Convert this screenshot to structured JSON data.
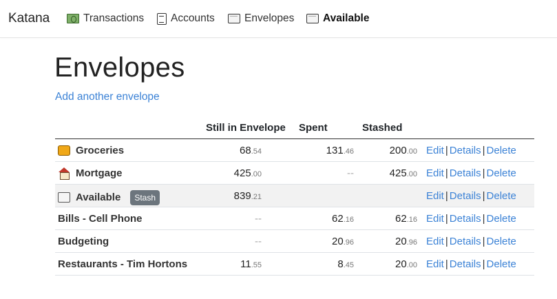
{
  "navbar": {
    "brand": "Katana",
    "items": [
      {
        "label": "Transactions",
        "icon": "money-icon",
        "active": false
      },
      {
        "label": "Accounts",
        "icon": "ledger-icon",
        "active": false
      },
      {
        "label": "Envelopes",
        "icon": "envelope-icon",
        "active": false
      },
      {
        "label": "Available",
        "icon": "envelope-icon",
        "active": true
      }
    ]
  },
  "page": {
    "title": "Envelopes",
    "add_link": "Add another envelope"
  },
  "table": {
    "headers": {
      "still": "Still in Envelope",
      "spent": "Spent",
      "stashed": "Stashed"
    },
    "rows": [
      {
        "name": "Groceries",
        "icon": "groceries-icon",
        "still_whole": "68",
        "still_cents": ".54",
        "spent_whole": "131",
        "spent_cents": ".46",
        "stashed_whole": "200",
        "stashed_cents": ".00",
        "edit": "Edit",
        "details": "Details",
        "delete": "Delete"
      },
      {
        "name": "Mortgage",
        "icon": "house-icon",
        "still_whole": "425",
        "still_cents": ".00",
        "spent_empty": "--",
        "stashed_whole": "425",
        "stashed_cents": ".00",
        "edit": "Edit",
        "details": "Details",
        "delete": "Delete"
      },
      {
        "name": "Available",
        "icon": "envelope-icon",
        "badge": "Stash",
        "still_whole": "839",
        "still_cents": ".21",
        "edit": "Edit",
        "details": "Details",
        "delete": "Delete"
      },
      {
        "name": "Bills - Cell Phone",
        "still_empty": "--",
        "spent_whole": "62",
        "spent_cents": ".16",
        "stashed_whole": "62",
        "stashed_cents": ".16",
        "edit": "Edit",
        "details": "Details",
        "delete": "Delete"
      },
      {
        "name": "Budgeting",
        "still_empty": "--",
        "spent_whole": "20",
        "spent_cents": ".96",
        "stashed_whole": "20",
        "stashed_cents": ".96",
        "edit": "Edit",
        "details": "Details",
        "delete": "Delete"
      },
      {
        "name": "Restaurants - Tim Hortons",
        "still_whole": "11",
        "still_cents": ".55",
        "spent_whole": "8",
        "spent_cents": ".45",
        "stashed_whole": "20",
        "stashed_cents": ".00",
        "edit": "Edit",
        "details": "Details",
        "delete": "Delete"
      }
    ],
    "separator": "|"
  },
  "colors": {
    "link": "#3b82d6",
    "badge": "#6c757d",
    "highlight_row": "#f2f2f2"
  }
}
